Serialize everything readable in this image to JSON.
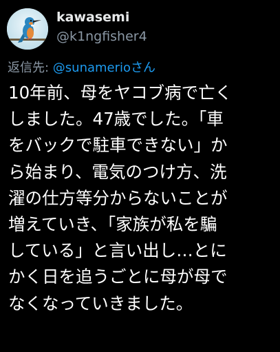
{
  "author": {
    "name": "kawasemi",
    "handle": "@k1ngfisher4"
  },
  "reply": {
    "prefix": "返信先: ",
    "target": "@sunamerioさん"
  },
  "body_lines": [
    "10年前、母をヤコブ病で亡く",
    "しました。47歳でした。「車",
    "をバックで駐車できない」か",
    "ら始まり、電気のつけ方、洗",
    "濯の仕方等分からないことが",
    "増えていき、「家族が私を騙",
    "している」と言い出し…とに",
    "かく日を追うごとに母が母で",
    "なくなっていきました。"
  ],
  "colors": {
    "background": "#000000",
    "text": "#ffffff",
    "secondary": "#8b98a5",
    "link": "#1d9bf0"
  },
  "icons": {
    "avatar": "kingfisher-bird-icon"
  }
}
